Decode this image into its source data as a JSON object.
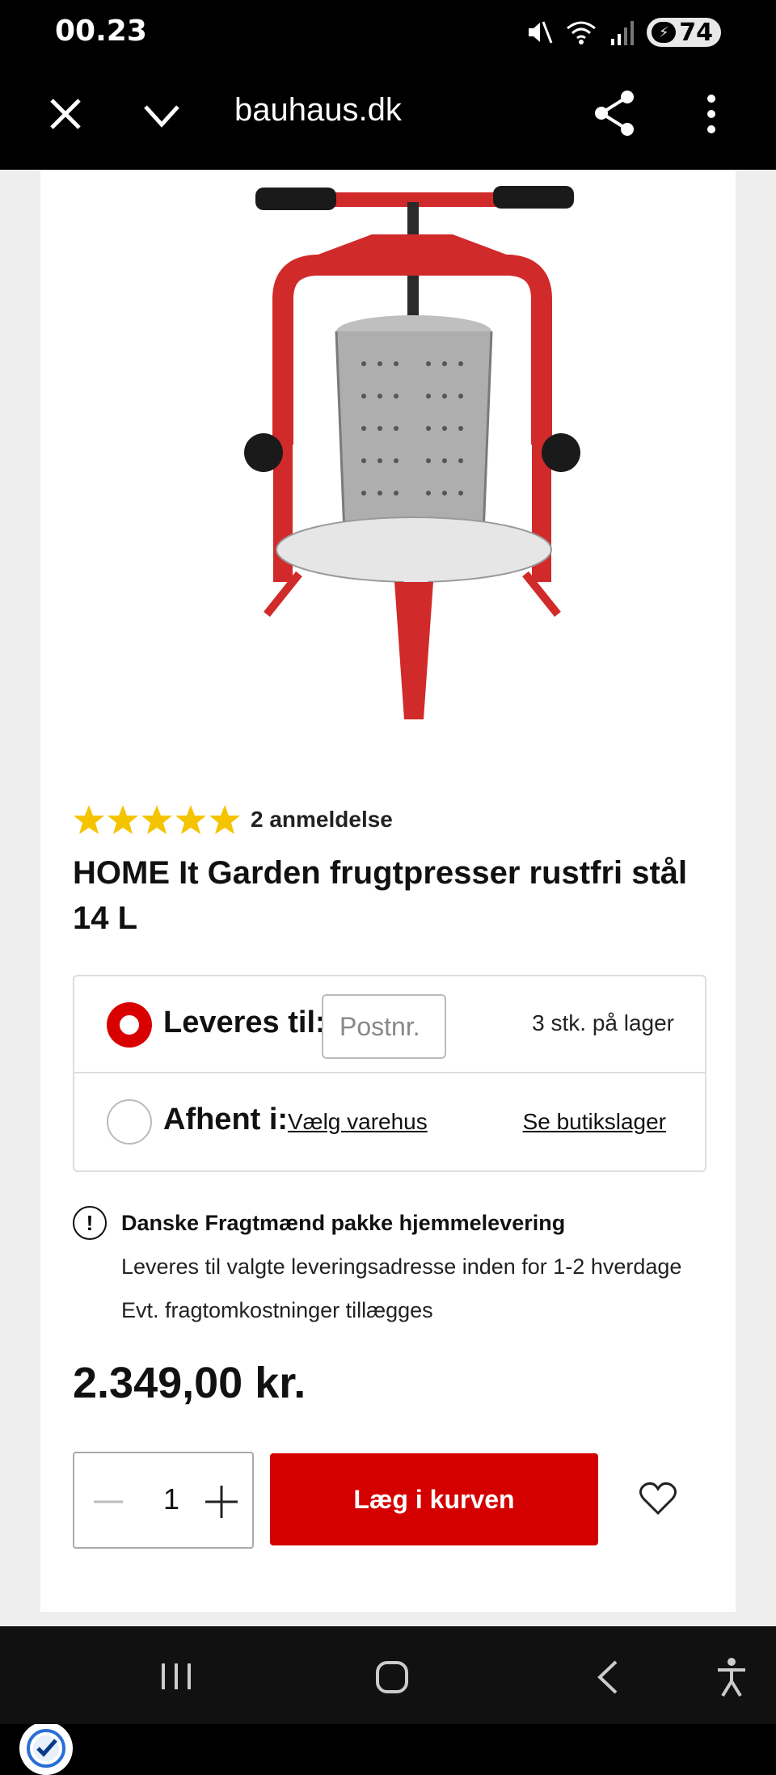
{
  "status": {
    "time": "00.23",
    "battery": "74",
    "icons": [
      "mute-icon",
      "wifi-icon",
      "signal-icon",
      "battery-icon"
    ]
  },
  "browser": {
    "url": "bauhaus.dk",
    "icons": [
      "close-icon",
      "chevron-down-icon",
      "share-icon",
      "more-vertical-icon"
    ]
  },
  "product": {
    "rating": 5,
    "review_count": "2 anmeldelse",
    "title": "HOME It Garden frugtpresser rustfri stål 14 L",
    "image": "fruit-press-image"
  },
  "delivery": {
    "ship_label": "Leveres til:",
    "postnr_placeholder": "Postnr.",
    "stock": "3 stk. på lager",
    "pickup_label": "Afhent i:",
    "choose_store": "Vælg varehus",
    "store_stock": "Se butikslager",
    "selected": "ship"
  },
  "info": {
    "heading": "Danske Fragtmænd pakke hjemmelevering",
    "line1": "Leveres til valgte leveringsadresse inden for 1-2 hverdage",
    "line2": "Evt. fragtomkostninger tillægges"
  },
  "price": "2.349,00 kr.",
  "cart": {
    "quantity": "1",
    "add_label": "Læg i kurven"
  },
  "colors": {
    "accent": "#d40000",
    "star": "#f5c400"
  }
}
